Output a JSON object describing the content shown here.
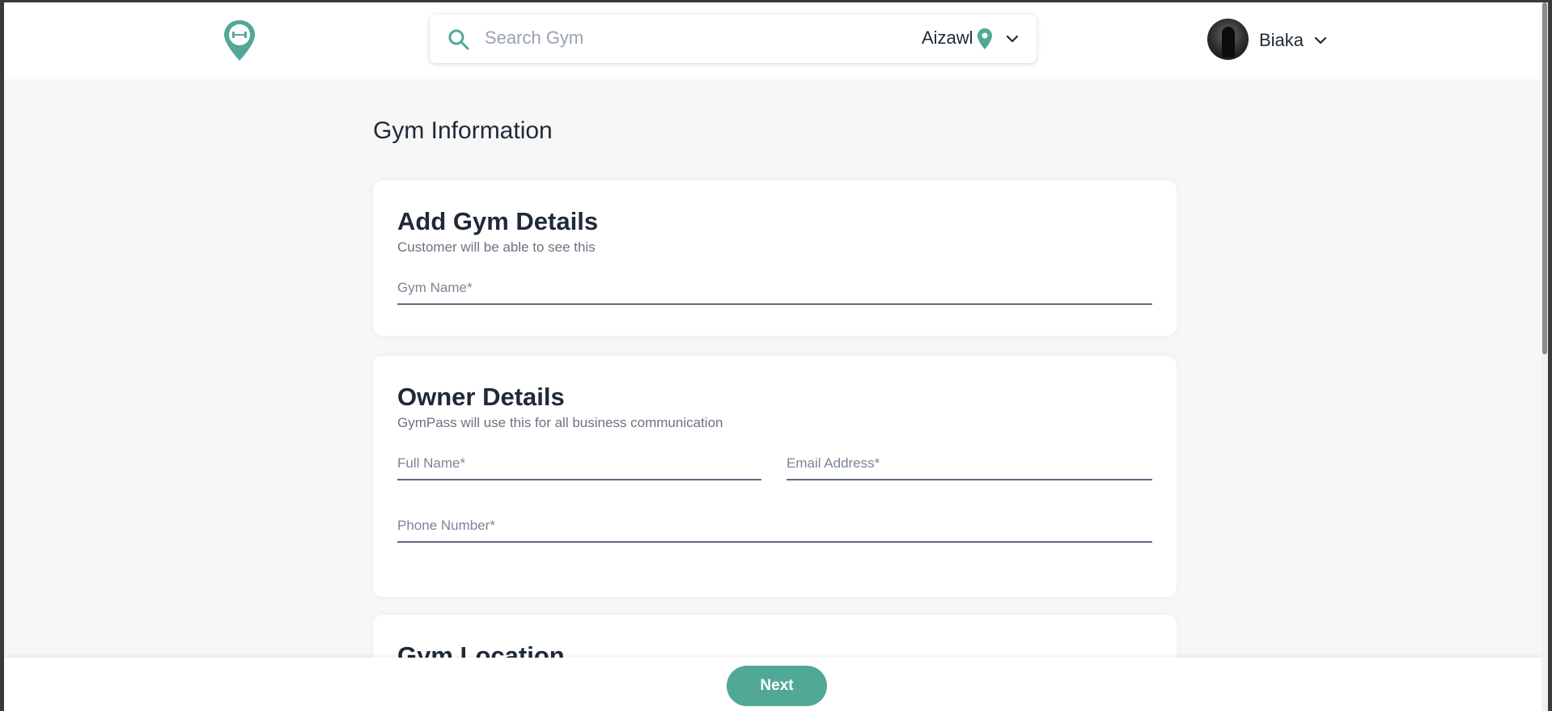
{
  "header": {
    "logo_icon": "dumbbell-location-pin-icon",
    "search": {
      "placeholder": "Search Gym",
      "city": "Aizawl",
      "city_icon": "location-pin-icon"
    },
    "user": {
      "name": "Biaka"
    }
  },
  "page": {
    "title": "Gym Information"
  },
  "cards": {
    "gym_details": {
      "title": "Add Gym Details",
      "subtitle": "Customer will be able to see this",
      "gym_name_placeholder": "Gym Name*"
    },
    "owner_details": {
      "title": "Owner Details",
      "subtitle": "GymPass will use this for all business communication",
      "full_name_placeholder": "Full Name*",
      "email_placeholder": "Email Address*",
      "phone_placeholder": "Phone Number*"
    },
    "gym_location": {
      "title": "Gym Location"
    }
  },
  "footer": {
    "next_label": "Next"
  },
  "colors": {
    "accent": "#52a896",
    "text_dark": "#1f2937",
    "field_line": "#5d6b80"
  }
}
